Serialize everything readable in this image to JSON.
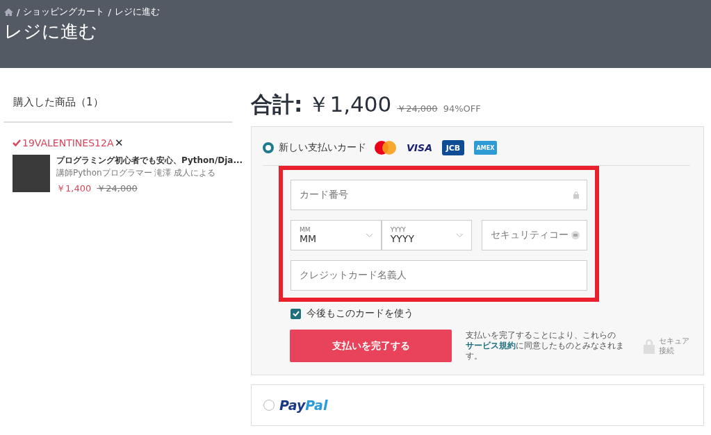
{
  "breadcrumb": {
    "items": [
      {
        "label": "ショッピングカート"
      },
      {
        "label": "レジに進む"
      }
    ],
    "separator": "/"
  },
  "page_title": "レジに進む",
  "cart": {
    "heading": "購入した商品（1）",
    "coupon": {
      "code": "19VALENTINES12A",
      "remove": "✕"
    },
    "items": [
      {
        "title": "プログラミング初心者でも安心、Python/Dja...",
        "instructor": "講師Pythonプログラマー 滝澤 成人による",
        "price": "￥1,400",
        "original_price": "￥24,000"
      }
    ]
  },
  "total": {
    "label": "合計:",
    "price": "￥1,400",
    "original_price": "￥24,000",
    "discount": "94%OFF"
  },
  "payment_methods": [
    {
      "kind": "card",
      "selected": true,
      "label": "新しい支払いカード",
      "logos": [
        {
          "kind": "mastercard"
        },
        {
          "kind": "visa",
          "text": "VISA"
        },
        {
          "kind": "jcb",
          "text": "JCB"
        },
        {
          "kind": "amex",
          "text": "AMEX"
        }
      ],
      "card_number": {
        "placeholder": "カード番号"
      },
      "month": {
        "label": "MM",
        "value": "MM"
      },
      "year": {
        "label": "YYYY",
        "value": "YYYY"
      },
      "security_code": {
        "placeholder": "セキュリティコー"
      },
      "holder": {
        "placeholder": "クレジットカード名義人"
      },
      "save_card": {
        "label": "今後もこのカードを使う",
        "checked": true
      },
      "submit": "支払いを完了する",
      "terms": {
        "before": "支払いを完了することにより、これらの",
        "link": "サービス規約",
        "after": "に同意したものとみなされます。"
      },
      "secure": "セキュア接続"
    },
    {
      "kind": "paypal",
      "selected": false,
      "logo_parts": [
        "Pay",
        "Pal"
      ]
    }
  ]
}
